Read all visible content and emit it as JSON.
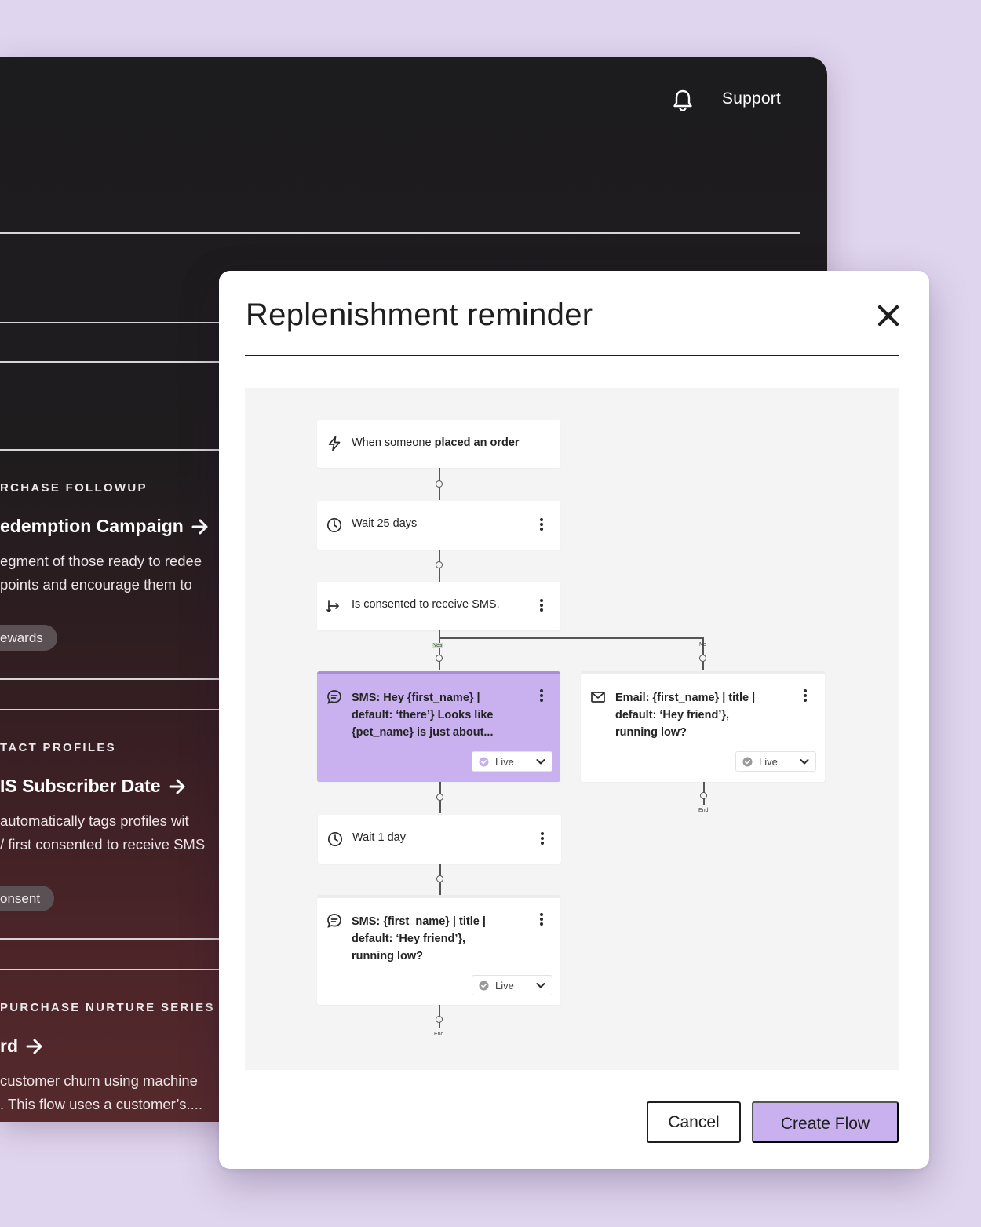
{
  "header": {
    "support_label": "Support",
    "notification_icon": "bell-icon"
  },
  "cards": [
    {
      "eyebrow": "RCHASE FOLLOWUP",
      "title": "edemption Campaign",
      "desc_line1": "egment of those ready to redee",
      "desc_line2": " points and encourage them to",
      "tag": "ewards"
    },
    {
      "eyebrow": "TACT PROFILES",
      "title": "IS Subscriber Date",
      "desc_line1": " automatically tags profiles wit",
      "desc_line2": "/ first consented to receive SMS",
      "tag": "onsent"
    },
    {
      "eyebrow": "PURCHASE NURTURE SERIES",
      "title": "rd",
      "desc_line1": "customer churn using machine",
      "desc_line2": ". This flow uses a customer’s...."
    }
  ],
  "modal": {
    "title": "Replenishment reminder",
    "cancel_label": "Cancel",
    "create_label": "Create Flow"
  },
  "flow": {
    "trigger": {
      "prefix": "When someone ",
      "bold": "placed an order"
    },
    "wait1": "Wait 25 days",
    "split": "Is consented to receive SMS.",
    "yes_label": "Yes",
    "no_label": "No",
    "sms1": "SMS: Hey {first_name} |\ndefault: ‘there’} Looks like\n{pet_name} is just about...",
    "email1": "Email: {first_name} | title |\ndefault: ‘Hey friend’},\nrunning low?",
    "wait2": "Wait 1 day",
    "sms2": "SMS: {first_name} | title |\ndefault: ‘Hey friend’},\nrunning low?",
    "status_live": "Live",
    "end_label": "End"
  },
  "colors": {
    "page_bg": "#e0d5ef",
    "accent_purple": "#c9b1f0",
    "active_node": "#c8b1ee",
    "dark_window": "#1c1b1d"
  }
}
